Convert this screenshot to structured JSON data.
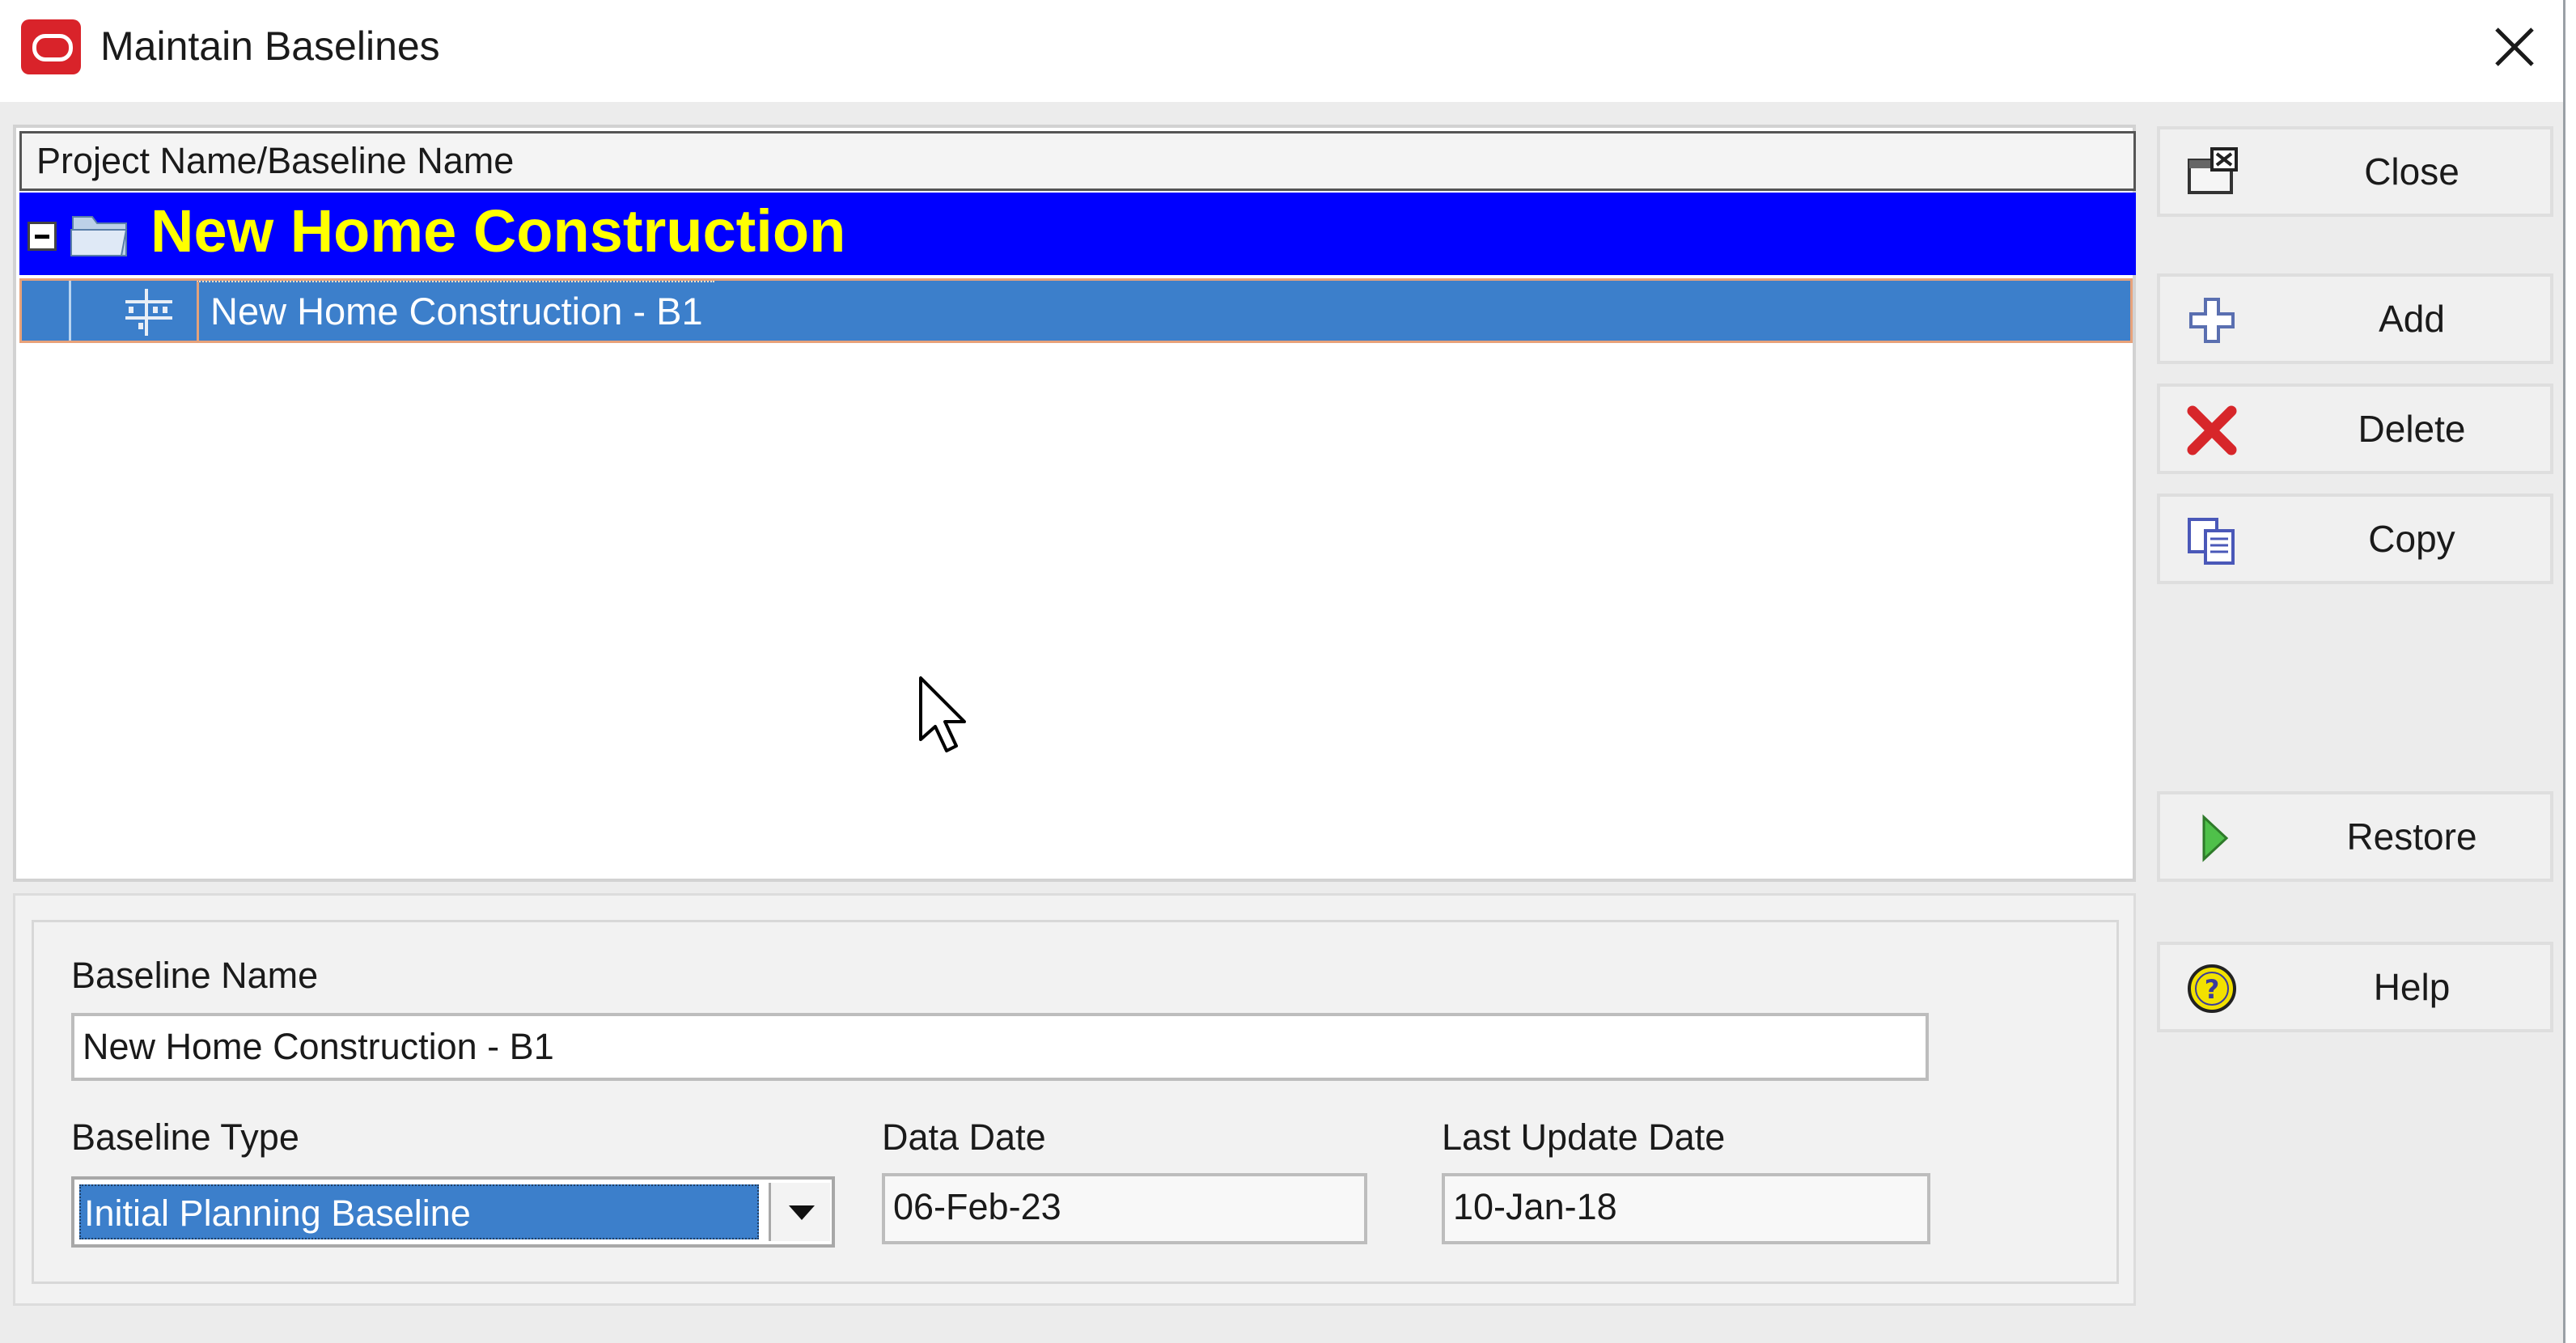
{
  "window": {
    "title": "Maintain Baselines"
  },
  "tree": {
    "column_header": "Project Name/Baseline Name",
    "project": {
      "name": "New Home Construction",
      "expanded": true
    },
    "baselines": [
      {
        "name": "New Home Construction - B1",
        "selected": true
      }
    ]
  },
  "details": {
    "baseline_name_label": "Baseline Name",
    "baseline_name_value": "New Home Construction - B1",
    "baseline_type_label": "Baseline Type",
    "baseline_type_value": "Initial Planning Baseline",
    "data_date_label": "Data Date",
    "data_date_value": "06-Feb-23",
    "last_update_label": "Last Update Date",
    "last_update_value": "10-Jan-18"
  },
  "buttons": {
    "close": "Close",
    "add": "Add",
    "delete": "Delete",
    "copy": "Copy",
    "restore": "Restore",
    "help": "Help"
  },
  "icons": {
    "app": "oracle-logo-icon",
    "window_close": "close-x-icon",
    "project": "folder-icon",
    "baseline": "baseline-tree-icon",
    "close": "close-window-icon",
    "add": "plus-icon",
    "delete": "red-x-icon",
    "copy": "copy-icon",
    "restore": "play-icon",
    "help": "help-icon"
  },
  "colors": {
    "project_row_bg": "#0000ff",
    "project_text": "#ffff00",
    "selection": "#3c7fcb",
    "oracle_red": "#d9232a",
    "delete_red": "#d7262a",
    "restore_green": "#2e9c2a",
    "help_yellow": "#f2e100"
  }
}
